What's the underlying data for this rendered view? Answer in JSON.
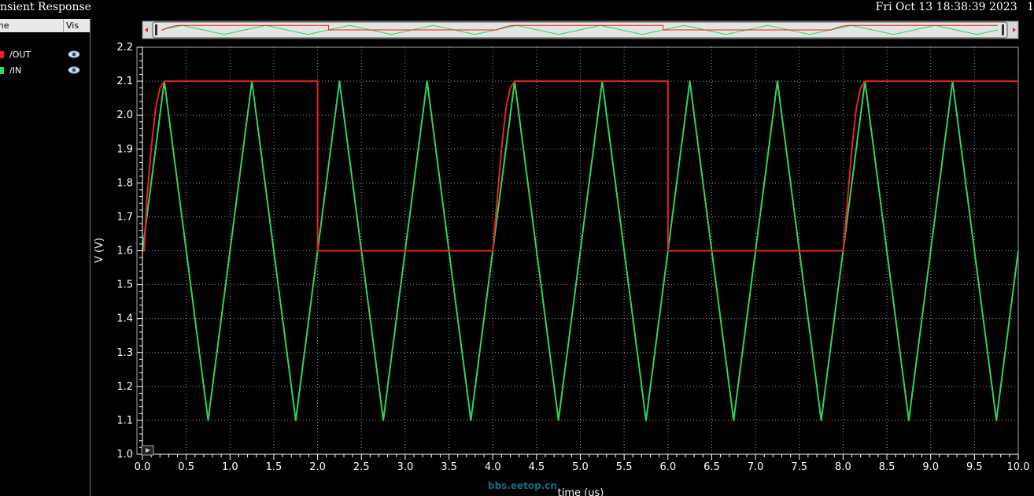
{
  "window": {
    "title": "nsient Response",
    "datetime": "Fri Oct 13 18:38:39 2023",
    "corner_text": "1"
  },
  "legend": {
    "header_name": "me",
    "header_vis": "Vis",
    "items": [
      {
        "label": "/OUT",
        "color": "#e8231d",
        "icon": "eye-icon"
      },
      {
        "label": "/IN",
        "color": "#2fd55d",
        "icon": "eye-icon"
      }
    ]
  },
  "watermark": "bbs.eetop.cn",
  "colors": {
    "grid": "#9a9a9a",
    "axis": "#ffffff",
    "background": "#000000"
  },
  "chart_data": {
    "type": "line",
    "title": "",
    "xlabel": "time (us)",
    "ylabel": "V (V)",
    "xlim": [
      0.0,
      10.0
    ],
    "ylim": [
      1.0,
      2.2
    ],
    "xticks": [
      "0.0",
      "0.5",
      "1.0",
      "1.5",
      "2.0",
      "2.5",
      "3.0",
      "3.5",
      "4.0",
      "4.5",
      "5.0",
      "5.5",
      "6.0",
      "6.5",
      "7.0",
      "7.5",
      "8.0",
      "8.5",
      "9.0",
      "9.5",
      "10.0"
    ],
    "yticks": [
      "1.0",
      "1.1",
      "1.2",
      "1.3",
      "1.4",
      "1.5",
      "1.6",
      "1.7",
      "1.8",
      "1.9",
      "2.0",
      "2.1",
      "2.2"
    ],
    "grid": true,
    "series": [
      {
        "name": "/OUT",
        "color": "#e8231d",
        "x": [
          0.0,
          0.02,
          0.05,
          0.1,
          0.15,
          0.2,
          0.25,
          2.0,
          2.0,
          4.0,
          4.05,
          4.1,
          4.15,
          4.2,
          4.25,
          6.0,
          6.0,
          8.0,
          8.05,
          8.1,
          8.15,
          8.2,
          8.25,
          10.0
        ],
        "y": [
          1.6,
          1.6,
          1.75,
          1.9,
          2.02,
          2.08,
          2.1,
          2.1,
          1.6,
          1.6,
          1.75,
          1.9,
          2.02,
          2.08,
          2.1,
          2.1,
          1.6,
          1.6,
          1.75,
          1.9,
          2.02,
          2.08,
          2.1,
          2.1
        ]
      },
      {
        "name": "/IN",
        "color": "#2fd55d",
        "x": [
          0.0,
          0.25,
          0.5,
          0.75,
          1.0,
          1.25,
          1.5,
          1.75,
          2.0,
          2.25,
          2.5,
          2.75,
          3.0,
          3.25,
          3.5,
          3.75,
          4.0,
          4.25,
          4.5,
          4.75,
          5.0,
          5.25,
          5.5,
          5.75,
          6.0,
          6.25,
          6.5,
          6.75,
          7.0,
          7.25,
          7.5,
          7.75,
          8.0,
          8.25,
          8.5,
          8.75,
          9.0,
          9.25,
          9.5,
          9.75,
          10.0
        ],
        "y": [
          1.6,
          2.1,
          1.6,
          1.1,
          1.6,
          2.1,
          1.6,
          1.1,
          1.6,
          2.1,
          1.6,
          1.1,
          1.6,
          2.1,
          1.6,
          1.1,
          1.6,
          2.1,
          1.6,
          1.1,
          1.6,
          2.1,
          1.6,
          1.1,
          1.6,
          2.1,
          1.6,
          1.1,
          1.6,
          2.1,
          1.6,
          1.1,
          1.6,
          2.1,
          1.6,
          1.1,
          1.6,
          2.1,
          1.6,
          1.1,
          1.6
        ]
      }
    ]
  }
}
